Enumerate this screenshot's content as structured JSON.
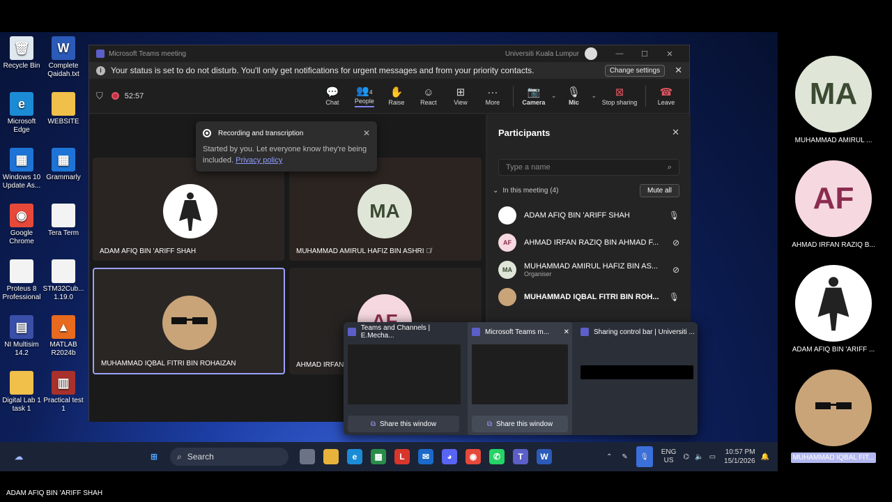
{
  "desktop": {
    "icons": [
      {
        "label": "Recycle Bin",
        "glyph": "🗑",
        "bg": "#dfe7ef"
      },
      {
        "label": "Complete Qaidah.txt",
        "glyph": "W",
        "bg": "#2b5ab8"
      },
      {
        "label": "Microsoft Edge",
        "glyph": "e",
        "bg": "#1c8bd6"
      },
      {
        "label": "WEBSITE",
        "glyph": "",
        "bg": "#f1c04a"
      },
      {
        "label": "Windows 10 Update As...",
        "glyph": "▦",
        "bg": "#1e74d6"
      },
      {
        "label": "Grammarly",
        "glyph": "▦",
        "bg": "#1e74d6"
      },
      {
        "label": "Google Chrome",
        "glyph": "◉",
        "bg": "#e6493a"
      },
      {
        "label": "Tera Term",
        "glyph": "",
        "bg": "#f3f3f3"
      },
      {
        "label": "Proteus 8 Professional",
        "glyph": "",
        "bg": "#f3f3f3"
      },
      {
        "label": "STM32Cub... 1.19.0",
        "glyph": "",
        "bg": "#f3f3f3"
      },
      {
        "label": "NI Multisim 14.2",
        "glyph": "▤",
        "bg": "#3a4fa8"
      },
      {
        "label": "MATLAB R2024b",
        "glyph": "▲",
        "bg": "#e76a1f"
      },
      {
        "label": "Digital Lab 1 task 1",
        "glyph": "",
        "bg": "#f1c04a"
      },
      {
        "label": "Practical test 1",
        "glyph": "▥",
        "bg": "#a8322b"
      }
    ]
  },
  "teams": {
    "window_title": "Microsoft Teams meeting",
    "org": "Universiti Kuala Lumpur",
    "banner": {
      "text": "Your status is set to do not disturb. You'll only get notifications for urgent messages and from your priority contacts.",
      "button": "Change settings"
    },
    "timer": "52:57",
    "toolbar": {
      "chat": "Chat",
      "people": "People",
      "people_count": "4",
      "raise": "Raise",
      "react": "React",
      "view": "View",
      "more": "More",
      "camera": "Camera",
      "mic": "Mic",
      "stop_sharing": "Stop sharing",
      "leave": "Leave"
    },
    "recording_popup": {
      "title": "Recording and transcription",
      "body": "Started by you. Let everyone know they're being included.",
      "link": "Privacy policy"
    },
    "tiles": [
      {
        "name": "ADAM AFIQ BIN 'ARIFF SHAH"
      },
      {
        "name": "MUHAMMAD AMIRUL HAFIZ BIN ASHRI",
        "initials": "MA"
      },
      {
        "name": "MUHAMMAD IQBAL FITRI BIN ROHAIZAN"
      },
      {
        "name": "AHMAD IRFAN I",
        "initials": "AF"
      }
    ],
    "participants": {
      "title": "Participants",
      "search_placeholder": "Type a name",
      "section": "In this meeting (4)",
      "mute_all": "Mute all",
      "list": [
        {
          "name": "ADAM AFIQ BIN 'ARIFF SHAH",
          "initials": "",
          "sub": ""
        },
        {
          "name": "AHMAD IRFAN RAZIQ BIN AHMAD F...",
          "initials": "AF",
          "sub": ""
        },
        {
          "name": "MUHAMMAD AMIRUL HAFIZ BIN AS...",
          "initials": "MA",
          "sub": "Organiser"
        },
        {
          "name": "MUHAMMAD IQBAL FITRI BIN ROH...",
          "initials": "",
          "sub": ""
        }
      ]
    }
  },
  "thumbnails": [
    {
      "title": "Teams and Channels | E.Mecha...",
      "share": "Share this window"
    },
    {
      "title": "Microsoft Teams m...",
      "share": "Share this window"
    },
    {
      "title": "Sharing control bar | Universiti ..."
    }
  ],
  "taskbar": {
    "search": "Search",
    "lang": "ENG",
    "region": "US",
    "time": "10:57 PM",
    "date": "15/1/2026"
  },
  "gallery": [
    {
      "name": "MUHAMMAD AMIRUL ...",
      "initials": "MA"
    },
    {
      "name": "AHMAD IRFAN RAZIQ B...",
      "initials": "AF"
    },
    {
      "name": "ADAM AFIQ BIN 'ARIFF ..."
    },
    {
      "name": "MUHAMMAD IQBAL FIT..."
    }
  ],
  "speaker_label": "ADAM AFIQ BIN 'ARIFF SHAH"
}
